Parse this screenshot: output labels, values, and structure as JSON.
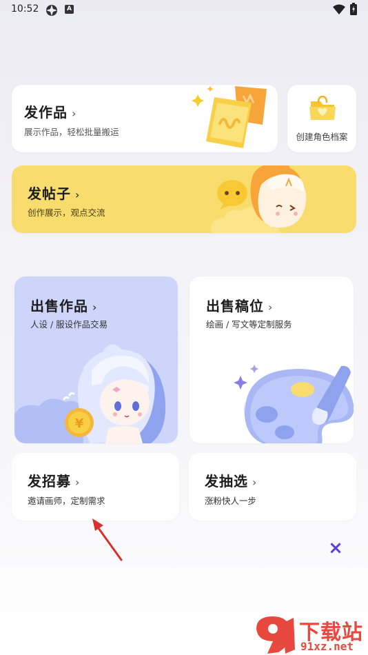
{
  "status_bar": {
    "time": "10:52",
    "a_badge": "A"
  },
  "cards": {
    "post_work": {
      "title": "发作品",
      "chevron": "›",
      "subtitle": "展示作品，轻松批量搬运"
    },
    "create_profile": {
      "label": "创建角色档案"
    },
    "post_thread": {
      "title": "发帖子",
      "chevron": "›",
      "subtitle": "创作展示，观点交流"
    },
    "sell_work": {
      "title": "出售作品",
      "chevron": "›",
      "subtitle": "人设 / 服设作品交易"
    },
    "sell_slot": {
      "title": "出售稿位",
      "chevron": "›",
      "subtitle": "绘画 / 写文等定制服务"
    },
    "recruit": {
      "title": "发招募",
      "chevron": "›",
      "subtitle": "邀请画师，定制需求"
    },
    "lottery": {
      "title": "发抽选",
      "chevron": "›",
      "subtitle": "涨粉快人一步"
    }
  },
  "close_glyph": "×",
  "watermark": {
    "site": "下载站",
    "url": "91xz.net"
  },
  "colors": {
    "accent_yellow": "#f8dc6e",
    "purple_card": "#cdd5fb",
    "close": "#5b3fd6"
  }
}
